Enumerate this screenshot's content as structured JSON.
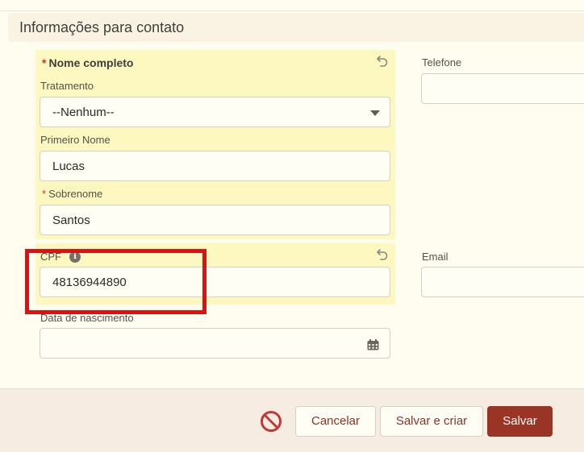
{
  "section": {
    "title": "Informações para contato"
  },
  "name_group": {
    "label": "Nome completo",
    "required_mark": "*",
    "salutation": {
      "label": "Tratamento",
      "value": "--Nenhum--"
    },
    "first_name": {
      "label": "Primeiro Nome",
      "value": "Lucas"
    },
    "last_name": {
      "label": "Sobrenome",
      "required_mark": "*",
      "value": "Santos"
    }
  },
  "phone": {
    "label": "Telefone",
    "value": ""
  },
  "cpf": {
    "label": "CPF",
    "value": "48136944890"
  },
  "email": {
    "label": "Email",
    "value": ""
  },
  "birthdate": {
    "label": "Data de nascimento",
    "value": ""
  },
  "footer": {
    "cancel_label": "Cancelar",
    "save_new_label": "Salvar e criar",
    "save_label": "Salvar"
  },
  "icons": {
    "undo": "undo-icon",
    "info": "info-icon",
    "calendar": "calendar-icon",
    "dropdown": "chevron-down-icon",
    "cancel": "prohibited-icon"
  },
  "colors": {
    "highlight": "#fcf8c0",
    "primary_button": "#9a3424",
    "annotation_box": "#e01010"
  }
}
